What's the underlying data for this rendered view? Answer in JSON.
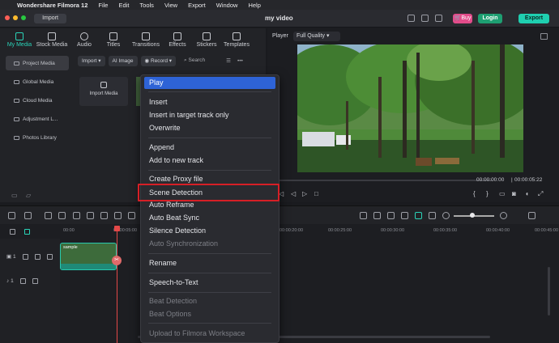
{
  "menubar": {
    "app_name": "Wondershare Filmora 12",
    "items": [
      "File",
      "Edit",
      "Tools",
      "View",
      "Export",
      "Window",
      "Help"
    ]
  },
  "titlebar": {
    "import_label": "Import",
    "title": "my video",
    "buy_label": "Buy",
    "login_label": "Login",
    "export_label": "Export"
  },
  "media_tabs": [
    "My Media",
    "Stock Media",
    "Audio",
    "Titles",
    "Transitions",
    "Effects",
    "Stickers",
    "Templates"
  ],
  "folders": [
    "Project Media",
    "Global Media",
    "Cloud Media",
    "Adjustment L...",
    "Photos Library"
  ],
  "media_toolbar": {
    "import_label": "Import",
    "ai_image_label": "AI Image",
    "record_label": "Record",
    "search_placeholder": "Search"
  },
  "import_card_label": "Import Media",
  "player": {
    "label": "Player",
    "quality": "Full Quality",
    "current_time": "00:00:00:00",
    "total_time": "00:00:05:22"
  },
  "timeline": {
    "ticks": [
      "00:00",
      "00:00:05:00",
      "00:00:20:00",
      "00:00:25:00",
      "00:00:30:00",
      "00:00:35:00",
      "00:00:40:00",
      "00:00:45:00"
    ],
    "video_track_label": "1",
    "audio_track_label": "1",
    "clip_label": "sample"
  },
  "context_menu": {
    "items": [
      {
        "label": "Play",
        "state": "highlight"
      },
      {
        "label": "Insert",
        "state": "normal"
      },
      {
        "label": "Insert in target track only",
        "state": "normal"
      },
      {
        "label": "Overwrite",
        "state": "normal"
      },
      {
        "label": "Append",
        "state": "normal"
      },
      {
        "label": "Add to new track",
        "state": "normal"
      },
      {
        "label": "Create Proxy file",
        "state": "normal"
      },
      {
        "label": "Scene Detection",
        "state": "normal"
      },
      {
        "label": "Auto Reframe",
        "state": "normal"
      },
      {
        "label": "Auto Beat Sync",
        "state": "normal"
      },
      {
        "label": "Silence Detection",
        "state": "normal"
      },
      {
        "label": "Auto Synchronization",
        "state": "disabled"
      },
      {
        "label": "Rename",
        "state": "normal"
      },
      {
        "label": "Speech-to-Text",
        "state": "normal"
      },
      {
        "label": "Beat Detection",
        "state": "disabled"
      },
      {
        "label": "Beat Options",
        "state": "disabled"
      },
      {
        "label": "Upload to Filmora Workspace",
        "state": "disabled"
      }
    ]
  },
  "colors": {
    "accent": "#2ad3b8",
    "highlight": "#2e63d6",
    "annotation_box": "#d61f26",
    "buy": "#e24c8a",
    "login": "#1e9f72",
    "export": "#1fcfb0",
    "playhead": "#e34848"
  }
}
